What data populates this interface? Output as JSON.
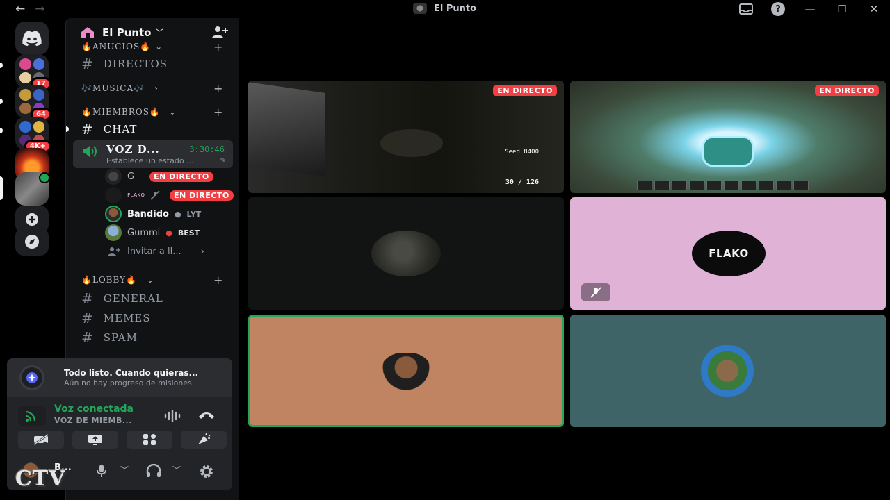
{
  "window": {
    "title": "El Punto",
    "back": "←",
    "forward": "→",
    "help": "?",
    "minimize": "—",
    "maximize": "☐",
    "close": "✕"
  },
  "rail": {
    "badges": [
      "17",
      "64",
      "4K+"
    ]
  },
  "server": {
    "name": "El Punto",
    "chevron": "﹀"
  },
  "channels": {
    "categories": [
      {
        "label": "🔥ANUCIOS🔥",
        "chevron": "⌄"
      },
      {
        "label": "🎶MUSICA🎶",
        "chevron": "›"
      },
      {
        "label": "🔥MIEMBROS🔥",
        "chevron": "⌄"
      },
      {
        "label": "🔥LOBBY🔥",
        "chevron": "⌄"
      }
    ],
    "plus": "+",
    "text": [
      {
        "name": "DIRECTOS"
      },
      {
        "name": "CHAT"
      },
      {
        "name": "GENERAL"
      },
      {
        "name": "MEMES"
      },
      {
        "name": "SPAM"
      }
    ],
    "hash": "#",
    "voice": {
      "name": "VOZ D...",
      "timer": "3:30:46",
      "status": "Establece un estado ..."
    },
    "voice_users": [
      {
        "name": "G",
        "live": "EN DIRECTO"
      },
      {
        "name": "ꜰʟᴀᴋᴏ",
        "live": "EN DIRECTO"
      },
      {
        "name": "Bandido",
        "activity": "LYT"
      },
      {
        "name": "Gummi",
        "activity": "BEST"
      }
    ],
    "invite": "Invitar a ll...",
    "invite_chevron": "›"
  },
  "quest": {
    "title": "Todo listo. Cuando quieras...",
    "subtitle": "Aún no hay progreso de misiones"
  },
  "voice_panel": {
    "status": "Voz conectada",
    "channel": "VOZ DE MIEMB..."
  },
  "user": {
    "name": "B...",
    "tag": "..."
  },
  "watermark": "CTV",
  "stage": {
    "live_label": "EN DIRECTO",
    "hud_speed": "Seed 8400",
    "ammo": "30 / 126",
    "flako_label": "FLAKO"
  },
  "colors": {
    "live": "#f23f43",
    "connected": "#23a55a",
    "flako_tile": "#e0b3d6",
    "speaking_tile": "#c08462",
    "gg_tile": "#3f6467"
  }
}
